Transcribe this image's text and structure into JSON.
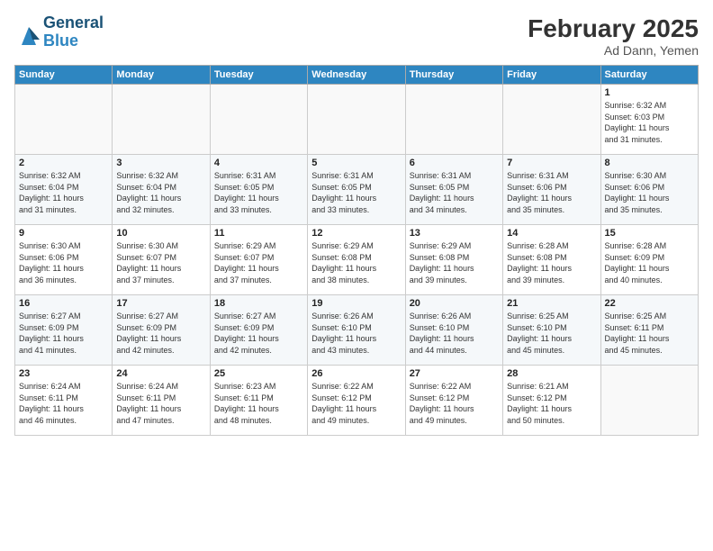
{
  "header": {
    "logo_line1": "General",
    "logo_line2": "Blue",
    "title": "February 2025",
    "subtitle": "Ad Dann, Yemen"
  },
  "weekdays": [
    "Sunday",
    "Monday",
    "Tuesday",
    "Wednesday",
    "Thursday",
    "Friday",
    "Saturday"
  ],
  "weeks": [
    [
      {
        "day": "",
        "info": ""
      },
      {
        "day": "",
        "info": ""
      },
      {
        "day": "",
        "info": ""
      },
      {
        "day": "",
        "info": ""
      },
      {
        "day": "",
        "info": ""
      },
      {
        "day": "",
        "info": ""
      },
      {
        "day": "1",
        "info": "Sunrise: 6:32 AM\nSunset: 6:03 PM\nDaylight: 11 hours\nand 31 minutes."
      }
    ],
    [
      {
        "day": "2",
        "info": "Sunrise: 6:32 AM\nSunset: 6:04 PM\nDaylight: 11 hours\nand 31 minutes."
      },
      {
        "day": "3",
        "info": "Sunrise: 6:32 AM\nSunset: 6:04 PM\nDaylight: 11 hours\nand 32 minutes."
      },
      {
        "day": "4",
        "info": "Sunrise: 6:31 AM\nSunset: 6:05 PM\nDaylight: 11 hours\nand 33 minutes."
      },
      {
        "day": "5",
        "info": "Sunrise: 6:31 AM\nSunset: 6:05 PM\nDaylight: 11 hours\nand 33 minutes."
      },
      {
        "day": "6",
        "info": "Sunrise: 6:31 AM\nSunset: 6:05 PM\nDaylight: 11 hours\nand 34 minutes."
      },
      {
        "day": "7",
        "info": "Sunrise: 6:31 AM\nSunset: 6:06 PM\nDaylight: 11 hours\nand 35 minutes."
      },
      {
        "day": "8",
        "info": "Sunrise: 6:30 AM\nSunset: 6:06 PM\nDaylight: 11 hours\nand 35 minutes."
      }
    ],
    [
      {
        "day": "9",
        "info": "Sunrise: 6:30 AM\nSunset: 6:06 PM\nDaylight: 11 hours\nand 36 minutes."
      },
      {
        "day": "10",
        "info": "Sunrise: 6:30 AM\nSunset: 6:07 PM\nDaylight: 11 hours\nand 37 minutes."
      },
      {
        "day": "11",
        "info": "Sunrise: 6:29 AM\nSunset: 6:07 PM\nDaylight: 11 hours\nand 37 minutes."
      },
      {
        "day": "12",
        "info": "Sunrise: 6:29 AM\nSunset: 6:08 PM\nDaylight: 11 hours\nand 38 minutes."
      },
      {
        "day": "13",
        "info": "Sunrise: 6:29 AM\nSunset: 6:08 PM\nDaylight: 11 hours\nand 39 minutes."
      },
      {
        "day": "14",
        "info": "Sunrise: 6:28 AM\nSunset: 6:08 PM\nDaylight: 11 hours\nand 39 minutes."
      },
      {
        "day": "15",
        "info": "Sunrise: 6:28 AM\nSunset: 6:09 PM\nDaylight: 11 hours\nand 40 minutes."
      }
    ],
    [
      {
        "day": "16",
        "info": "Sunrise: 6:27 AM\nSunset: 6:09 PM\nDaylight: 11 hours\nand 41 minutes."
      },
      {
        "day": "17",
        "info": "Sunrise: 6:27 AM\nSunset: 6:09 PM\nDaylight: 11 hours\nand 42 minutes."
      },
      {
        "day": "18",
        "info": "Sunrise: 6:27 AM\nSunset: 6:09 PM\nDaylight: 11 hours\nand 42 minutes."
      },
      {
        "day": "19",
        "info": "Sunrise: 6:26 AM\nSunset: 6:10 PM\nDaylight: 11 hours\nand 43 minutes."
      },
      {
        "day": "20",
        "info": "Sunrise: 6:26 AM\nSunset: 6:10 PM\nDaylight: 11 hours\nand 44 minutes."
      },
      {
        "day": "21",
        "info": "Sunrise: 6:25 AM\nSunset: 6:10 PM\nDaylight: 11 hours\nand 45 minutes."
      },
      {
        "day": "22",
        "info": "Sunrise: 6:25 AM\nSunset: 6:11 PM\nDaylight: 11 hours\nand 45 minutes."
      }
    ],
    [
      {
        "day": "23",
        "info": "Sunrise: 6:24 AM\nSunset: 6:11 PM\nDaylight: 11 hours\nand 46 minutes."
      },
      {
        "day": "24",
        "info": "Sunrise: 6:24 AM\nSunset: 6:11 PM\nDaylight: 11 hours\nand 47 minutes."
      },
      {
        "day": "25",
        "info": "Sunrise: 6:23 AM\nSunset: 6:11 PM\nDaylight: 11 hours\nand 48 minutes."
      },
      {
        "day": "26",
        "info": "Sunrise: 6:22 AM\nSunset: 6:12 PM\nDaylight: 11 hours\nand 49 minutes."
      },
      {
        "day": "27",
        "info": "Sunrise: 6:22 AM\nSunset: 6:12 PM\nDaylight: 11 hours\nand 49 minutes."
      },
      {
        "day": "28",
        "info": "Sunrise: 6:21 AM\nSunset: 6:12 PM\nDaylight: 11 hours\nand 50 minutes."
      },
      {
        "day": "",
        "info": ""
      }
    ]
  ]
}
